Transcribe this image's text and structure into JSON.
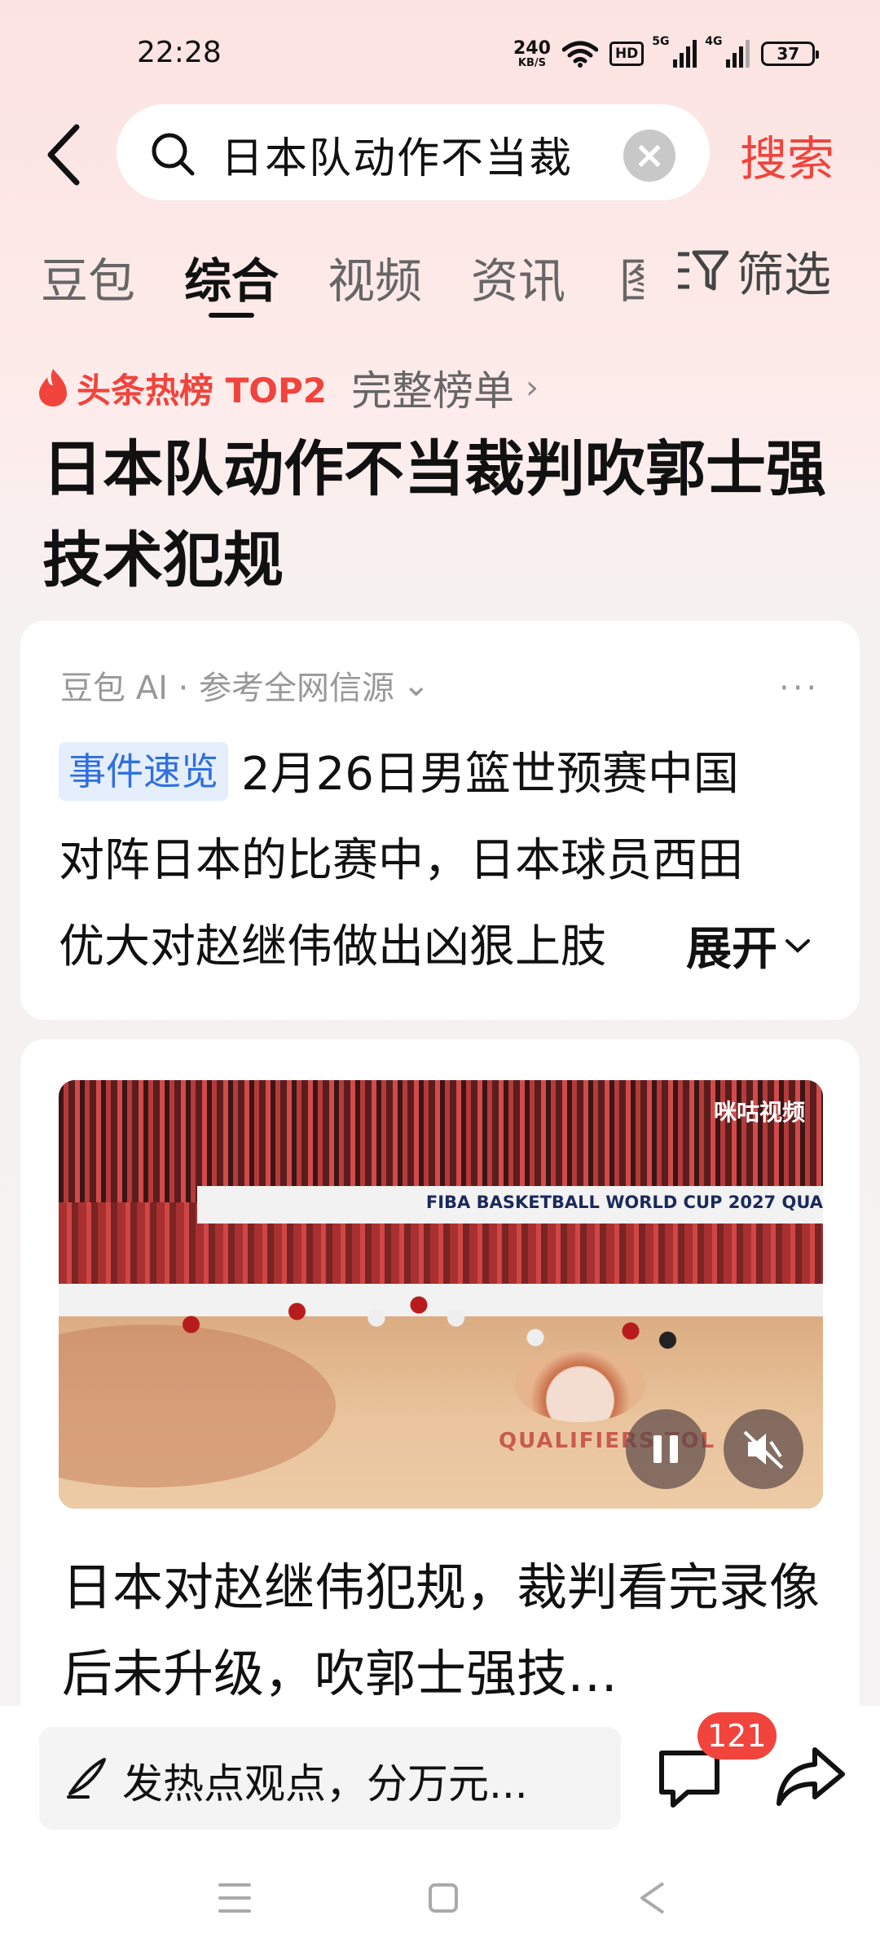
{
  "status_bar": {
    "time": "22:28",
    "net_speed": "240",
    "net_speed_unit": "KB/S",
    "hd": "HD",
    "sig1_label": "5G",
    "sig2_label": "4G",
    "battery": "37"
  },
  "search": {
    "query": "日本队动作不当裁",
    "button_label": "搜索"
  },
  "tabs": {
    "items": [
      "豆包",
      "综合",
      "视频",
      "资讯"
    ],
    "active": "综合",
    "cut": "图",
    "filter_label": "筛选"
  },
  "hot": {
    "label": "头条热榜 TOP2",
    "full_list": "完整榜单",
    "chevron": "›"
  },
  "topic": {
    "title": "日本队动作不当裁判吹郭士强技术犯规"
  },
  "ai_card": {
    "source": "豆包 AI · 参考全网信源",
    "source_chevron": "⌄",
    "more": "···",
    "tag": "事件速览",
    "line1": "2月26日男篮世预赛中国",
    "line2": "对阵日本的比赛中，日本球员西田",
    "line3": "优大对赵继伟做出凶狠上肢",
    "expand": "展开"
  },
  "video_card": {
    "watermark": "咪咕视频",
    "banner_text": "FIBA BASKETBALL WORLD CUP 2027 QUA",
    "court_text": "QUALIFIERS TOL",
    "title": "日本对赵继伟犯规，裁判看完录像后未升级，吹郭士强技…"
  },
  "bottom": {
    "comment_placeholder": "发热点观点，分万元...",
    "comment_count": "121"
  },
  "colors": {
    "accent": "#f0443c",
    "tag_bg": "#e4eefc",
    "tag_fg": "#2f6fe0"
  }
}
